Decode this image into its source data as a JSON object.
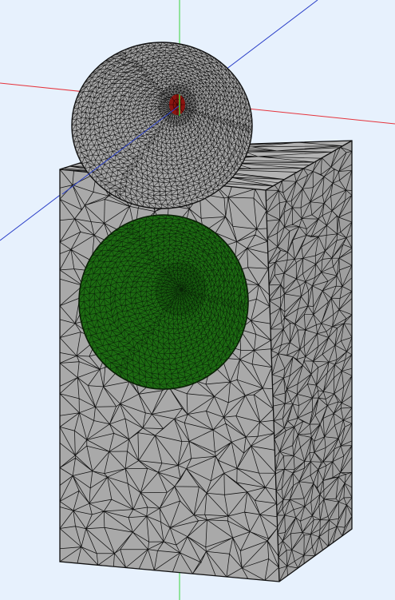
{
  "viewport": {
    "background": "#e7f1fd",
    "axes": {
      "x_color": "#e5343c",
      "y_color": "#3ad23a",
      "z_color": "#2a3fc8"
    },
    "model": {
      "parts": [
        {
          "name": "speaker-enclosure-mesh",
          "face_color": "#a9a9a9",
          "edge_color": "#111111"
        },
        {
          "name": "woofer-cone-mesh",
          "face_color": "#1d6b12",
          "edge_color": "#0a2608"
        },
        {
          "name": "tweeter-horn-mesh",
          "face_color": "#a6a6a6",
          "edge_color": "#111111"
        },
        {
          "name": "tweeter-driver-mesh",
          "face_color": "#8b1410",
          "edge_color": "#2a0000"
        }
      ]
    }
  }
}
